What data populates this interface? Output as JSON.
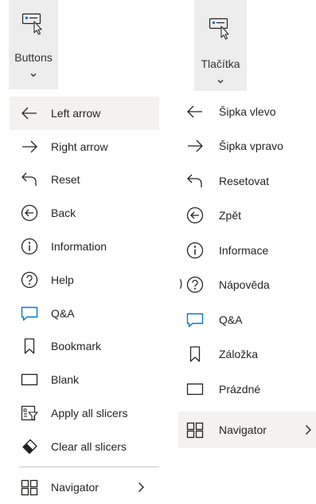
{
  "left": {
    "ribbon": {
      "label": "Buttons",
      "icon": "button-cursor-icon",
      "chevron": "chevron-down-icon"
    },
    "items": [
      {
        "label": "Left arrow",
        "icon": "left-arrow-icon"
      },
      {
        "label": "Right arrow",
        "icon": "right-arrow-icon"
      },
      {
        "label": "Reset",
        "icon": "reset-icon"
      },
      {
        "label": "Back",
        "icon": "back-icon"
      },
      {
        "label": "Information",
        "icon": "information-icon"
      },
      {
        "label": "Help",
        "icon": "help-icon"
      },
      {
        "label": "Q&A",
        "icon": "qna-icon"
      },
      {
        "label": "Bookmark",
        "icon": "bookmark-icon"
      },
      {
        "label": "Blank",
        "icon": "blank-icon"
      },
      {
        "label": "Apply all slicers",
        "icon": "apply-slicers-icon"
      },
      {
        "label": "Clear all slicers",
        "icon": "clear-slicers-icon"
      }
    ],
    "navigator": {
      "label": "Navigator",
      "icon": "navigator-icon",
      "chevron": "chevron-right-icon"
    }
  },
  "right": {
    "ribbon": {
      "label": "Tlačítka",
      "icon": "button-cursor-icon",
      "chevron": "chevron-down-icon"
    },
    "items": [
      {
        "label": "Šipka vlevo",
        "icon": "left-arrow-icon"
      },
      {
        "label": "Šipka vpravo",
        "icon": "right-arrow-icon"
      },
      {
        "label": "Resetovat",
        "icon": "reset-icon"
      },
      {
        "label": "Zpět",
        "icon": "back-icon"
      },
      {
        "label": "Informace",
        "icon": "information-icon"
      },
      {
        "label": "Nápověda",
        "icon": "help-icon"
      },
      {
        "label": "Q&A",
        "icon": "qna-icon"
      },
      {
        "label": "Záložka",
        "icon": "bookmark-icon"
      },
      {
        "label": "Prázdné",
        "icon": "blank-icon"
      }
    ],
    "navigator": {
      "label": "Navigator",
      "icon": "navigator-icon",
      "chevron": "chevron-right-icon"
    }
  },
  "colors": {
    "icon": "#252423",
    "qna_accent": "#0078d4",
    "ribbon_bg": "#ededed",
    "hover_bg": "#f3f2f1",
    "divider": "#c8c6c4"
  }
}
